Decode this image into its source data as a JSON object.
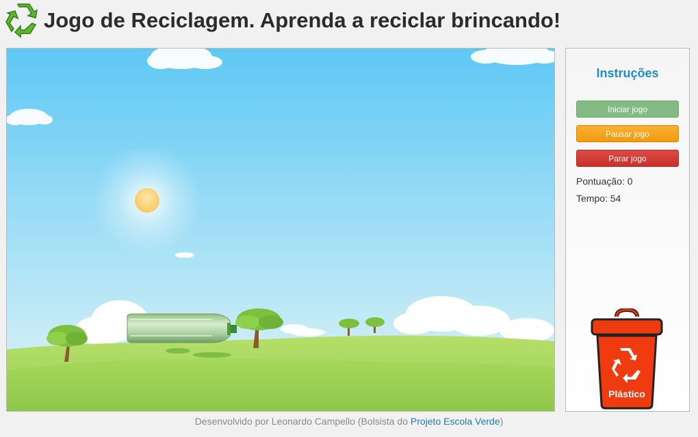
{
  "header": {
    "logo_icon": "recycle-icon",
    "title": "Jogo de Reciclagem. Aprenda a reciclar brincando!"
  },
  "game": {
    "falling_item": "plastic-bottle",
    "colors": {
      "sky_top": "#5ec8f5",
      "sky_bottom": "#c9ecf6",
      "grass": "#9ccf55"
    }
  },
  "panel": {
    "title": "Instruções",
    "buttons": {
      "start": "Iniciar jogo",
      "pause": "Pausar jogo",
      "stop": "Parar jogo"
    },
    "score_label": "Pontuação: 0",
    "time_label": "Tempo: 54",
    "bin": {
      "label": "Plástico",
      "color": "#f03a10",
      "icon": "recycle-icon"
    }
  },
  "footer": {
    "prefix": "Desenvolvido por Leonardo Campello (Bolsista do ",
    "link": "Projeto Escola Verde",
    "suffix": ")"
  }
}
